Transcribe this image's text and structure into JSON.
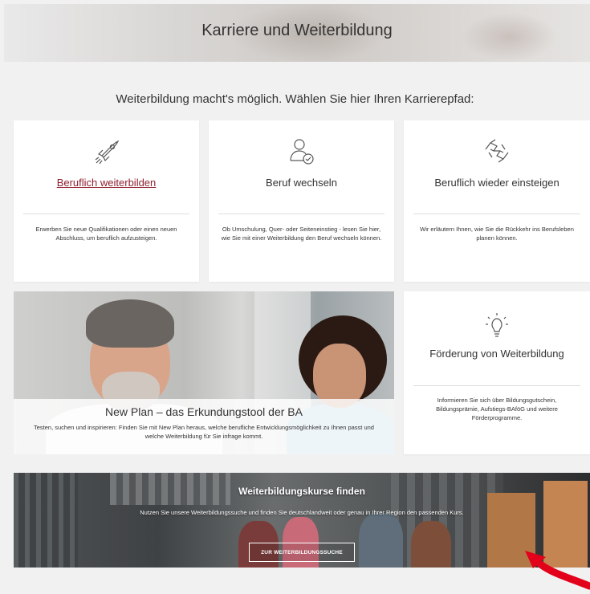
{
  "header": {
    "title": "Karriere und Weiterbildung"
  },
  "intro": "Weiterbildung macht's möglich. Wählen Sie hier Ihren Karrierepfad:",
  "cards": [
    {
      "icon": "rocket-icon",
      "title": "Beruflich weiterbilden",
      "description": "Erwerben Sie neue Qualifikationen oder einen neuen Abschluss, um beruflich aufzusteigen."
    },
    {
      "icon": "person-switch-icon",
      "title": "Beruf wechseln",
      "description": "Ob Umschulung, Quer- oder Seiteneinstieg - lesen Sie hier, wie Sie mit einer Weiterbildung den Beruf wechseln können."
    },
    {
      "icon": "handshake-icon",
      "title": "Beruflich wieder einsteigen",
      "description": "Wir erläutern Ihnen, wie Sie die Rückkehr ins Berufsleben planen können."
    },
    {
      "icon": "lightbulb-icon",
      "title": "Förderung von Weiterbildung",
      "description": "Informieren Sie sich über Bildungsgutschein, Bildungsprämie, Aufstiegs-BAföG und weitere Förderprogramme."
    }
  ],
  "promo": {
    "title": "New Plan – das Erkundungstool der BA",
    "description": "Testen, suchen und inspirieren: Finden Sie mit New Plan heraus, welche berufliche Entwicklungsmöglichkeit zu Ihnen passt und welche Weiterbildung für Sie infrage kommt."
  },
  "hero": {
    "title": "Weiterbildungskurse finden",
    "description": "Nutzen Sie unsere Weiterbildungssuche und finden Sie deutschlandweit oder genau in Ihrer Region den passenden Kurs.",
    "button_label": "ZUR WEITERBILDUNGSSUCHE"
  },
  "colors": {
    "link": "#8f1f2e",
    "arrow": "#e2001a",
    "background": "#f1f1f1"
  }
}
